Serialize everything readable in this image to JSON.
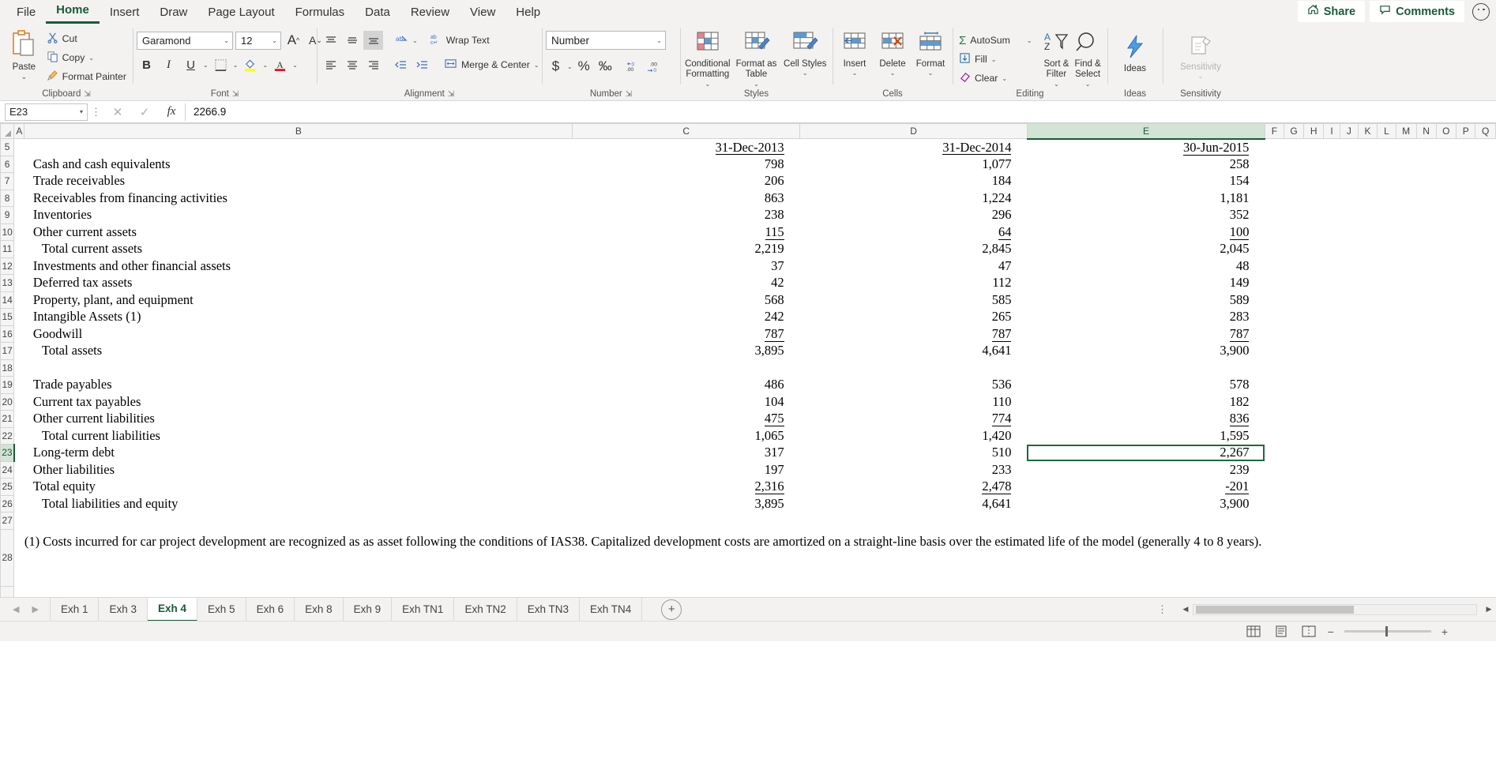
{
  "ribbon": {
    "tabs": [
      {
        "label": "File",
        "active": false
      },
      {
        "label": "Home",
        "active": true
      },
      {
        "label": "Insert",
        "active": false
      },
      {
        "label": "Draw",
        "active": false
      },
      {
        "label": "Page Layout",
        "active": false
      },
      {
        "label": "Formulas",
        "active": false
      },
      {
        "label": "Data",
        "active": false
      },
      {
        "label": "Review",
        "active": false
      },
      {
        "label": "View",
        "active": false
      },
      {
        "label": "Help",
        "active": false
      }
    ],
    "share_label": "Share",
    "comments_label": "Comments",
    "groups": {
      "clipboard": {
        "label": "Clipboard",
        "paste": "Paste",
        "cut": "Cut",
        "copy": "Copy",
        "format_painter": "Format Painter"
      },
      "font": {
        "label": "Font",
        "font_name": "Garamond",
        "font_size": "12",
        "grow_font": "A",
        "shrink_font": "A",
        "bold": "B",
        "italic": "I",
        "underline": "U"
      },
      "alignment": {
        "label": "Alignment",
        "wrap_text": "Wrap Text",
        "merge_center": "Merge & Center"
      },
      "number": {
        "label": "Number",
        "format": "Number",
        "currency": "$",
        "percent": "%",
        "comma": "‰"
      },
      "styles": {
        "label": "Styles",
        "conditional_formatting": "Conditional Formatting",
        "format_as_table": "Format as Table",
        "cell_styles": "Cell Styles"
      },
      "cells": {
        "label": "Cells",
        "insert": "Insert",
        "delete": "Delete",
        "format": "Format"
      },
      "editing": {
        "label": "Editing",
        "autosum": "AutoSum",
        "fill": "Fill",
        "clear": "Clear",
        "sort_filter": "Sort & Filter",
        "find_select": "Find & Select"
      },
      "ideas": {
        "label": "Ideas",
        "button": "Ideas"
      },
      "sensitivity": {
        "label": "Sensitivity",
        "button": "Sensitivity"
      }
    }
  },
  "formula_bar": {
    "name_box": "E23",
    "value": "2266.9",
    "cancel_icon": "close-icon",
    "confirm_icon": "check-icon",
    "function_icon": "fx"
  },
  "grid": {
    "columns": [
      "A",
      "B",
      "C",
      "D",
      "E",
      "F",
      "G",
      "H",
      "I",
      "J",
      "K",
      "L",
      "M",
      "N",
      "O",
      "P",
      "Q"
    ],
    "selected_column": "E",
    "selected_row": "23",
    "selected_cell": "E23",
    "rows": [
      {
        "n": "5",
        "label": "",
        "c": "31-Dec-2013",
        "d": "31-Dec-2014",
        "e": "30-Jun-2015",
        "style": "header"
      },
      {
        "n": "6",
        "label": "Cash and cash equivalents",
        "c": "798",
        "d": "1,077",
        "e": "258",
        "style": "plain"
      },
      {
        "n": "7",
        "label": "Trade receivables",
        "c": "206",
        "d": "184",
        "e": "154",
        "style": "plain"
      },
      {
        "n": "8",
        "label": "Receivables from financing activities",
        "c": "863",
        "d": "1,224",
        "e": "1,181",
        "style": "plain"
      },
      {
        "n": "9",
        "label": "Inventories",
        "c": "238",
        "d": "296",
        "e": "352",
        "style": "plain"
      },
      {
        "n": "10",
        "label": "Other current assets",
        "c": "115",
        "d": "64",
        "e": "100",
        "style": "subtotal-rule"
      },
      {
        "n": "11",
        "label": "  Total current assets",
        "c": "2,219",
        "d": "2,845",
        "e": "2,045",
        "style": "total"
      },
      {
        "n": "12",
        "label": "Investments and other financial assets",
        "c": "37",
        "d": "47",
        "e": "48",
        "style": "plain"
      },
      {
        "n": "13",
        "label": "Deferred tax assets",
        "c": "42",
        "d": "112",
        "e": "149",
        "style": "plain"
      },
      {
        "n": "14",
        "label": "Property, plant, and equipment",
        "c": "568",
        "d": "585",
        "e": "589",
        "style": "plain"
      },
      {
        "n": "15",
        "label": "Intangible Assets (1)",
        "c": "242",
        "d": "265",
        "e": "283",
        "style": "plain"
      },
      {
        "n": "16",
        "label": "Goodwill",
        "c": "787",
        "d": "787",
        "e": "787",
        "style": "subtotal-rule"
      },
      {
        "n": "17",
        "label": "  Total assets",
        "c": "3,895",
        "d": "4,641",
        "e": "3,900",
        "style": "total"
      },
      {
        "n": "18",
        "label": "",
        "c": "",
        "d": "",
        "e": "",
        "style": "blank"
      },
      {
        "n": "19",
        "label": "Trade payables",
        "c": "486",
        "d": "536",
        "e": "578",
        "style": "plain"
      },
      {
        "n": "20",
        "label": "Current tax payables",
        "c": "104",
        "d": "110",
        "e": "182",
        "style": "plain"
      },
      {
        "n": "21",
        "label": "Other current liabilities",
        "c": "475",
        "d": "774",
        "e": "836",
        "style": "subtotal-rule"
      },
      {
        "n": "22",
        "label": "  Total current liabilities",
        "c": "1,065",
        "d": "1,420",
        "e": "1,595",
        "style": "total"
      },
      {
        "n": "23",
        "label": "Long-term debt",
        "c": "317",
        "d": "510",
        "e": "2,267",
        "style": "plain"
      },
      {
        "n": "24",
        "label": "Other liabilities",
        "c": "197",
        "d": "233",
        "e": "239",
        "style": "plain"
      },
      {
        "n": "25",
        "label": "Total equity",
        "c": "2,316",
        "d": "2,478",
        "e": "-201",
        "style": "subtotal-rule"
      },
      {
        "n": "26",
        "label": "  Total liabilities and equity",
        "c": "3,895",
        "d": "4,641",
        "e": "3,900",
        "style": "total"
      },
      {
        "n": "27",
        "label": "",
        "c": "",
        "d": "",
        "e": "",
        "style": "blank"
      }
    ],
    "note_row_number": "28",
    "note_text": "(1) Costs incurred for car project development are recognized as as asset following the conditions of IAS38. Capitalized development costs are amortized on a straight-line basis over the estimated life of the model (generally 4 to 8 years)."
  },
  "sheet_tabs": [
    {
      "label": "Exh 1",
      "active": false
    },
    {
      "label": "Exh 3",
      "active": false
    },
    {
      "label": "Exh 4",
      "active": true
    },
    {
      "label": "Exh 5",
      "active": false
    },
    {
      "label": "Exh 6",
      "active": false
    },
    {
      "label": "Exh 8",
      "active": false
    },
    {
      "label": "Exh 9",
      "active": false
    },
    {
      "label": "Exh TN1",
      "active": false
    },
    {
      "label": "Exh TN2",
      "active": false
    },
    {
      "label": "Exh TN3",
      "active": false
    },
    {
      "label": "Exh TN4",
      "active": false
    }
  ],
  "status_bar": {
    "zoom": ""
  },
  "colors": {
    "accent_green": "#185C37",
    "selection_green": "#1a6b3c",
    "ribbon_bg": "#f3f2f1"
  }
}
